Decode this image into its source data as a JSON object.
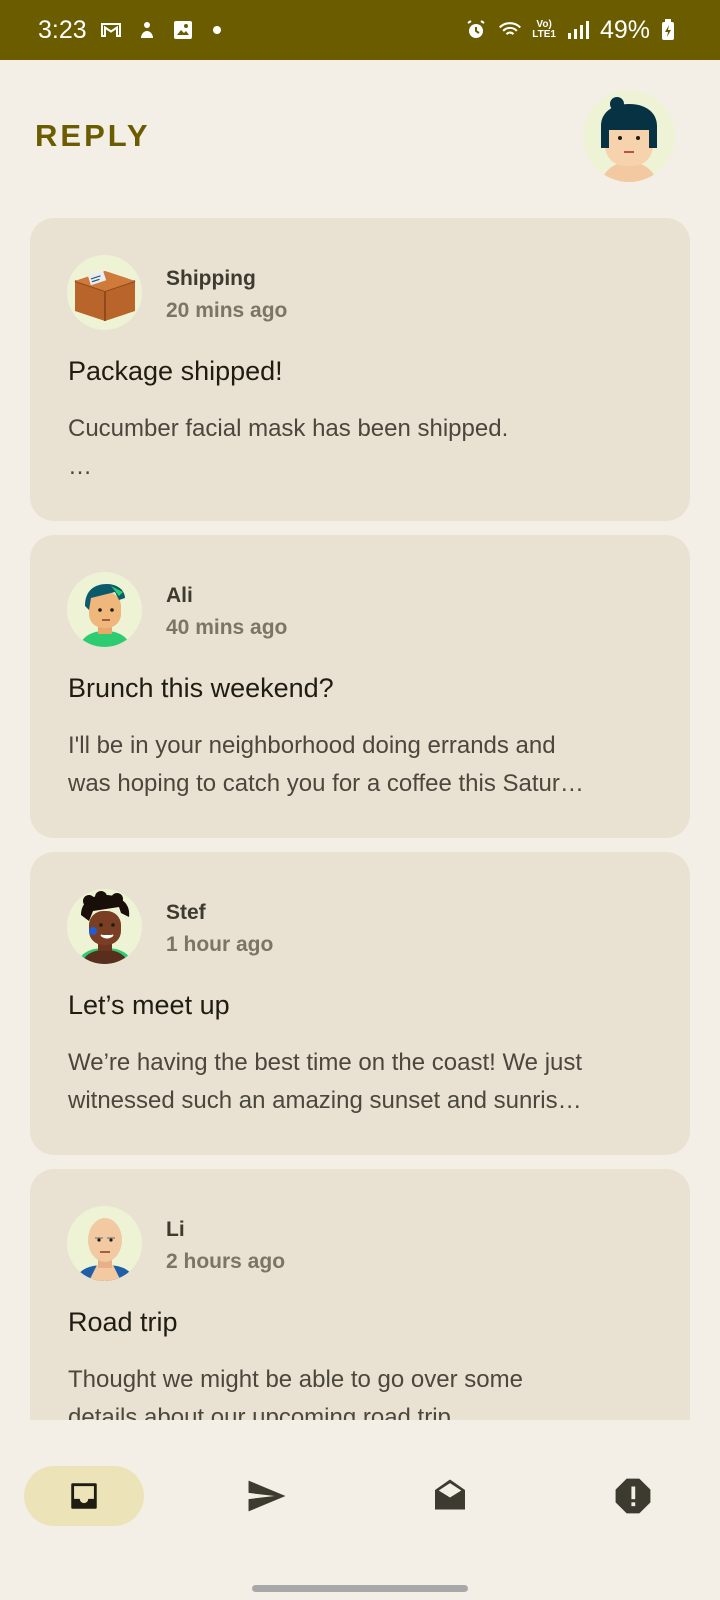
{
  "status_bar": {
    "time": "3:23",
    "battery": "49%",
    "network": "LTE1"
  },
  "app": {
    "title": "REPLY"
  },
  "emails": [
    {
      "sender": "Shipping",
      "time": "20 mins ago",
      "subject": "Package shipped!",
      "preview_line1": "Cucumber facial mask has been shipped.",
      "preview_line2": "…"
    },
    {
      "sender": "Ali",
      "time": "40 mins ago",
      "subject": "Brunch this weekend?",
      "preview_line1": "I'll be in your neighborhood doing errands and",
      "preview_line2": "was hoping to catch you for a coffee this Satur…"
    },
    {
      "sender": "Stef",
      "time": "1 hour ago",
      "subject": "Let’s meet up",
      "preview_line1": "We’re having the best time on the coast! We just",
      "preview_line2": "witnessed such an amazing sunset and sunris…"
    },
    {
      "sender": "Li",
      "time": "2 hours ago",
      "subject": "Road trip",
      "preview_line1": "Thought we might be able to go over some",
      "preview_line2": "details about our upcoming road trip."
    }
  ],
  "nav": {
    "items": [
      {
        "icon": "inbox-icon",
        "active": true
      },
      {
        "icon": "send-icon",
        "active": false
      },
      {
        "icon": "drafts-icon",
        "active": false
      },
      {
        "icon": "spam-icon",
        "active": false
      }
    ]
  },
  "colors": {
    "accent": "#6b5c00",
    "background": "#f3efe6",
    "card": "#e9e2d2",
    "nav_active": "#ece3b9"
  }
}
